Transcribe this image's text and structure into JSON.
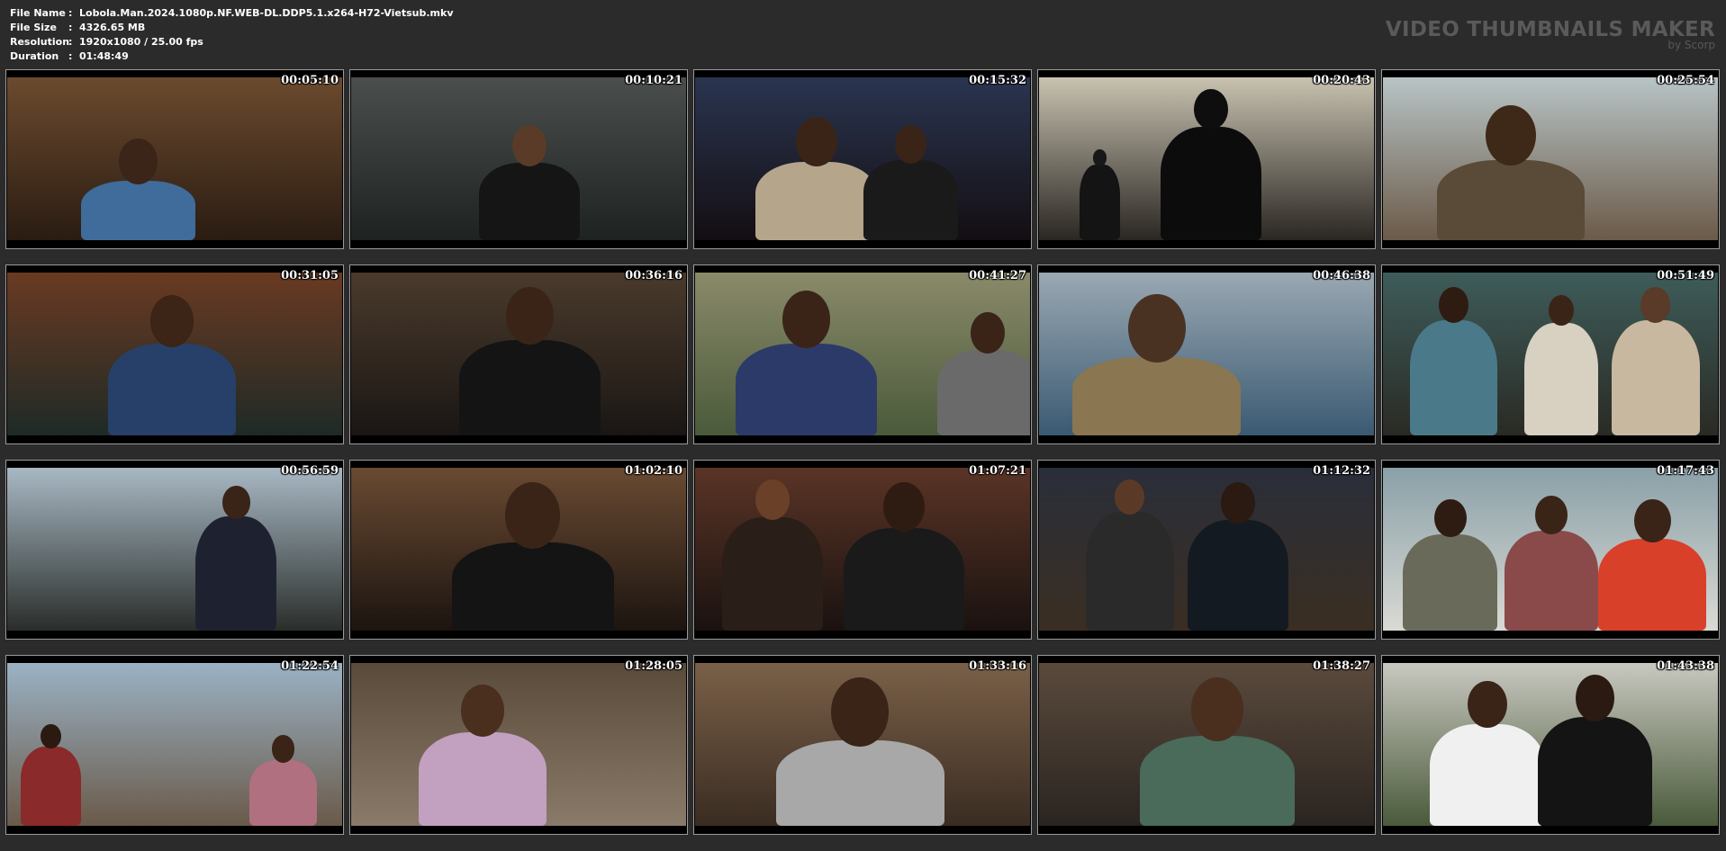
{
  "file_info": [
    {
      "label": "File Name",
      "value": "Lobola.Man.2024.1080p.NF.WEB-DL.DDP5.1.x264-H72-Vietsub.mkv"
    },
    {
      "label": "File Size",
      "value": "4326.65 MB"
    },
    {
      "label": "Resolution",
      "value": "1920x1080 / 25.00 fps"
    },
    {
      "label": "Duration",
      "value": "01:48:49"
    }
  ],
  "brand": {
    "title": "VIDEO THUMBNAILS MAKER",
    "subtitle": "by Scorp"
  },
  "thumbnails": [
    {
      "timestamp": "00:05:10",
      "bg": [
        "#6b4a2e",
        "#2a1c12"
      ],
      "figures": [
        {
          "x": 0.22,
          "skin": "#3b2418",
          "shirt": "#3f6c9a",
          "w": 0.34,
          "h": 0.62
        }
      ]
    },
    {
      "timestamp": "00:10:21",
      "bg": [
        "#4a4e4c",
        "#1e2220"
      ],
      "figures": [
        {
          "x": 0.38,
          "skin": "#5a3b28",
          "shirt": "#151515",
          "w": 0.3,
          "h": 0.7
        }
      ]
    },
    {
      "timestamp": "00:15:32",
      "bg": [
        "#2a3550",
        "#140e12"
      ],
      "figures": [
        {
          "x": 0.18,
          "skin": "#3a2418",
          "shirt": "#b5a58a",
          "w": 0.36,
          "h": 0.75
        },
        {
          "x": 0.5,
          "skin": "#3a2418",
          "shirt": "#1a1a1a",
          "w": 0.28,
          "h": 0.7
        }
      ]
    },
    {
      "timestamp": "00:20:43",
      "bg": [
        "#c8c2b0",
        "#2a2622"
      ],
      "figures": [
        {
          "x": 0.36,
          "skin": "#0e0e0e",
          "shirt": "#0c0c0c",
          "w": 0.3,
          "h": 0.92
        },
        {
          "x": 0.12,
          "skin": "#181818",
          "shirt": "#141414",
          "w": 0.12,
          "h": 0.55
        }
      ]
    },
    {
      "timestamp": "00:25:54",
      "bg": [
        "#b8c4c6",
        "#6b5a48"
      ],
      "figures": [
        {
          "x": 0.16,
          "skin": "#3e2818",
          "shirt": "#5a4a38",
          "w": 0.44,
          "h": 0.82
        }
      ]
    },
    {
      "timestamp": "00:31:05",
      "bg": [
        "#6a3a22",
        "#1e2a26"
      ],
      "figures": [
        {
          "x": 0.3,
          "skin": "#3c2416",
          "shirt": "#26406a",
          "w": 0.38,
          "h": 0.85
        }
      ]
    },
    {
      "timestamp": "00:36:16",
      "bg": [
        "#4a3a2c",
        "#1a1614"
      ],
      "figures": [
        {
          "x": 0.32,
          "skin": "#3a2418",
          "shirt": "#141414",
          "w": 0.42,
          "h": 0.9
        }
      ]
    },
    {
      "timestamp": "00:41:27",
      "bg": [
        "#8a8a6a",
        "#4a5a3a"
      ],
      "figures": [
        {
          "x": 0.12,
          "skin": "#3a2418",
          "shirt": "#2c3a6a",
          "w": 0.42,
          "h": 0.88
        },
        {
          "x": 0.72,
          "skin": "#3a2418",
          "shirt": "#6a6a6a",
          "w": 0.3,
          "h": 0.75
        }
      ]
    },
    {
      "timestamp": "00:46:38",
      "bg": [
        "#9aa8b2",
        "#3a5a72"
      ],
      "figures": [
        {
          "x": 0.1,
          "skin": "#4a3222",
          "shirt": "#8a7650",
          "w": 0.5,
          "h": 0.86
        }
      ]
    },
    {
      "timestamp": "00:51:49",
      "bg": [
        "#3e5c5a",
        "#2a2a24"
      ],
      "figures": [
        {
          "x": 0.08,
          "skin": "#2e1c12",
          "shirt": "#4a7a8a",
          "w": 0.26,
          "h": 0.9
        },
        {
          "x": 0.42,
          "skin": "#3a2418",
          "shirt": "#d8d0c0",
          "w": 0.22,
          "h": 0.85
        },
        {
          "x": 0.68,
          "skin": "#5a3a28",
          "shirt": "#c8b8a0",
          "w": 0.26,
          "h": 0.9
        }
      ]
    },
    {
      "timestamp": "00:56:59",
      "bg": [
        "#a8b8c4",
        "#2a2e2a"
      ],
      "figures": [
        {
          "x": 0.56,
          "skin": "#3a2418",
          "shirt": "#1e2230",
          "w": 0.24,
          "h": 0.88
        }
      ]
    },
    {
      "timestamp": "01:02:10",
      "bg": [
        "#6a4a32",
        "#1c1410"
      ],
      "figures": [
        {
          "x": 0.3,
          "skin": "#3a2418",
          "shirt": "#141414",
          "w": 0.48,
          "h": 0.9
        }
      ]
    },
    {
      "timestamp": "01:07:21",
      "bg": [
        "#5a3426",
        "#1a1210"
      ],
      "figures": [
        {
          "x": 0.08,
          "skin": "#6a4028",
          "shirt": "#2a1e18",
          "w": 0.3,
          "h": 0.92
        },
        {
          "x": 0.44,
          "skin": "#2e1c12",
          "shirt": "#1a1a1a",
          "w": 0.36,
          "h": 0.9
        }
      ]
    },
    {
      "timestamp": "01:12:32",
      "bg": [
        "#2a2e3a",
        "#3a2e22"
      ],
      "figures": [
        {
          "x": 0.14,
          "skin": "#5a3a26",
          "shirt": "#2a2a2a",
          "w": 0.26,
          "h": 0.92
        },
        {
          "x": 0.44,
          "skin": "#2a1a12",
          "shirt": "#141a22",
          "w": 0.3,
          "h": 0.9
        }
      ]
    },
    {
      "timestamp": "01:17:43",
      "bg": [
        "#8aa0a8",
        "#dadad4"
      ],
      "figures": [
        {
          "x": 0.06,
          "skin": "#2e1c12",
          "shirt": "#6a6a5a",
          "w": 0.28,
          "h": 0.8
        },
        {
          "x": 0.36,
          "skin": "#3a2418",
          "shirt": "#8a4a4a",
          "w": 0.28,
          "h": 0.82
        },
        {
          "x": 0.64,
          "skin": "#3a2418",
          "shirt": "#d8402a",
          "w": 0.32,
          "h": 0.8
        }
      ]
    },
    {
      "timestamp": "01:22:54",
      "bg": [
        "#9ab2c4",
        "#6a5a4a"
      ],
      "figures": [
        {
          "x": 0.04,
          "skin": "#2a1a12",
          "shirt": "#8a2a2a",
          "w": 0.18,
          "h": 0.62
        },
        {
          "x": 0.72,
          "skin": "#3a2418",
          "shirt": "#b07080",
          "w": 0.2,
          "h": 0.55
        }
      ]
    },
    {
      "timestamp": "01:28:05",
      "bg": [
        "#5a4a3a",
        "#8a7a6a"
      ],
      "figures": [
        {
          "x": 0.2,
          "skin": "#4a2e1e",
          "shirt": "#c2a0c0",
          "w": 0.38,
          "h": 0.86
        }
      ]
    },
    {
      "timestamp": "01:33:16",
      "bg": [
        "#7a6048",
        "#3a2c22"
      ],
      "figures": [
        {
          "x": 0.24,
          "skin": "#3a2418",
          "shirt": "#a8a8a8",
          "w": 0.5,
          "h": 0.9
        }
      ]
    },
    {
      "timestamp": "01:38:27",
      "bg": [
        "#5a4a3c",
        "#2a2420"
      ],
      "figures": [
        {
          "x": 0.3,
          "skin": "#4a2e1e",
          "shirt": "#4a6a5a",
          "w": 0.46,
          "h": 0.9
        }
      ]
    },
    {
      "timestamp": "01:43:38",
      "bg": [
        "#c8c8c0",
        "#4a5a3a"
      ],
      "figures": [
        {
          "x": 0.14,
          "skin": "#3a2418",
          "shirt": "#f0f0f0",
          "w": 0.34,
          "h": 0.88
        },
        {
          "x": 0.46,
          "skin": "#2a1a12",
          "shirt": "#141414",
          "w": 0.34,
          "h": 0.92
        }
      ]
    }
  ]
}
